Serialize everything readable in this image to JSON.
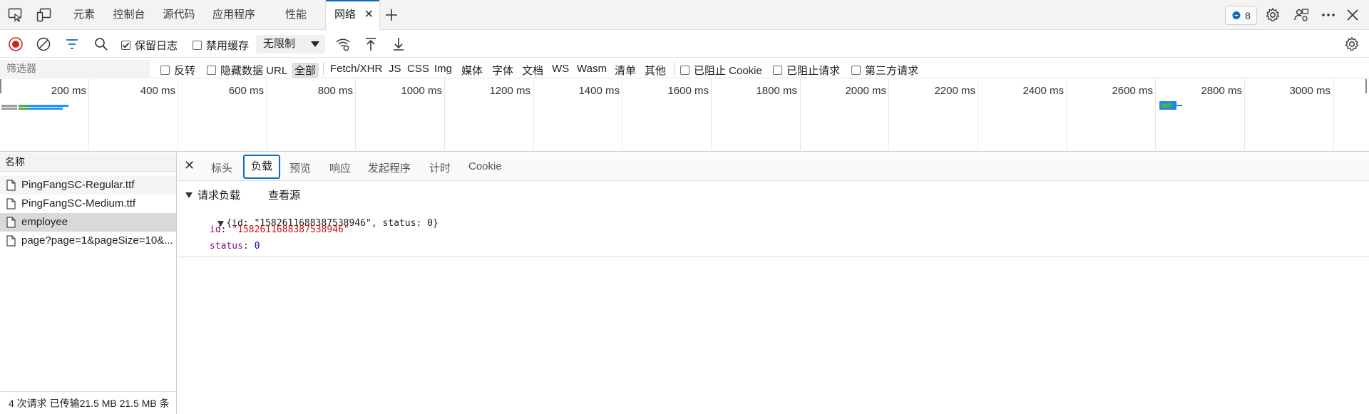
{
  "top_tabs": [
    {
      "label": "元素"
    },
    {
      "label": "控制台"
    },
    {
      "label": "源代码"
    },
    {
      "label": "应用程序"
    },
    {
      "label": "性能"
    },
    {
      "label": "网络"
    }
  ],
  "top_right": {
    "issues_count": "8"
  },
  "toolbar": {
    "preserve_log_label": "保留日志",
    "disable_cache_label": "禁用缓存",
    "throttling_value": "无限制"
  },
  "filter": {
    "placeholder": "筛选器",
    "invert_label": "反转",
    "hide_data_urls_label": "隐藏数据 URL",
    "types": [
      "全部",
      "Fetch/XHR",
      "JS",
      "CSS",
      "Img",
      "媒体",
      "字体",
      "文档",
      "WS",
      "Wasm",
      "清单",
      "其他"
    ],
    "blocked_cookies_label": "已阻止 Cookie",
    "blocked_requests_label": "已阻止请求",
    "third_party_label": "第三方请求"
  },
  "timeline": {
    "ticks": [
      "200 ms",
      "400 ms",
      "600 ms",
      "800 ms",
      "1000 ms",
      "1200 ms",
      "1400 ms",
      "1600 ms",
      "1800 ms",
      "2000 ms",
      "2200 ms",
      "2400 ms",
      "2600 ms",
      "2800 ms",
      "3000 ms"
    ]
  },
  "request_list": {
    "column_header": "名称",
    "items": [
      {
        "name": "PingFangSC-Regular.ttf"
      },
      {
        "name": "PingFangSC-Medium.ttf"
      },
      {
        "name": "employee"
      },
      {
        "name": "page?page=1&pageSize=10&..."
      }
    ],
    "status": "4 次请求   已传输21.5 MB   21.5 MB 条"
  },
  "detail": {
    "tabs": [
      "标头",
      "负载",
      "预览",
      "响应",
      "发起程序",
      "计时",
      "Cookie"
    ],
    "active_tab": "负载",
    "section_title": "请求负载",
    "view_source_label": "查看源",
    "payload_summary_open": "{id: ",
    "payload_summary_id": "\"1582611688387538946\"",
    "payload_summary_mid": ", status: ",
    "payload_summary_status": "0",
    "payload_summary_close": "}",
    "field_id_key": "id",
    "field_id_value": "\"1582611688387538946\"",
    "field_status_key": "status",
    "field_status_value": "0"
  }
}
